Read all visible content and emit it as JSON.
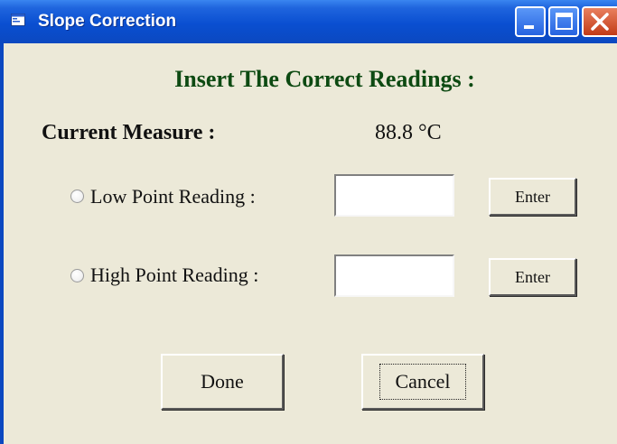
{
  "window": {
    "title": "Slope Correction",
    "icon": "app-window-icon"
  },
  "titlebar_buttons": [
    {
      "name": "minimize",
      "icon": "minimize-icon"
    },
    {
      "name": "maximize",
      "icon": "maximize-icon"
    },
    {
      "name": "close",
      "icon": "close-icon"
    }
  ],
  "heading": "Insert The Correct Readings :",
  "current": {
    "label": "Current Measure :",
    "value": "88.8  °C"
  },
  "rows": [
    {
      "label": "Low Point Reading :",
      "input_value": "",
      "button": "Enter",
      "selected": false
    },
    {
      "label": "High Point Reading :",
      "input_value": "",
      "button": "Enter",
      "selected": false
    }
  ],
  "actions": {
    "done": "Done",
    "cancel": "Cancel"
  },
  "colors": {
    "titlebar": "#0a4fd1",
    "heading": "#0d4a12",
    "dialog_bg": "#ece9d8",
    "close_button": "#c23b17"
  }
}
